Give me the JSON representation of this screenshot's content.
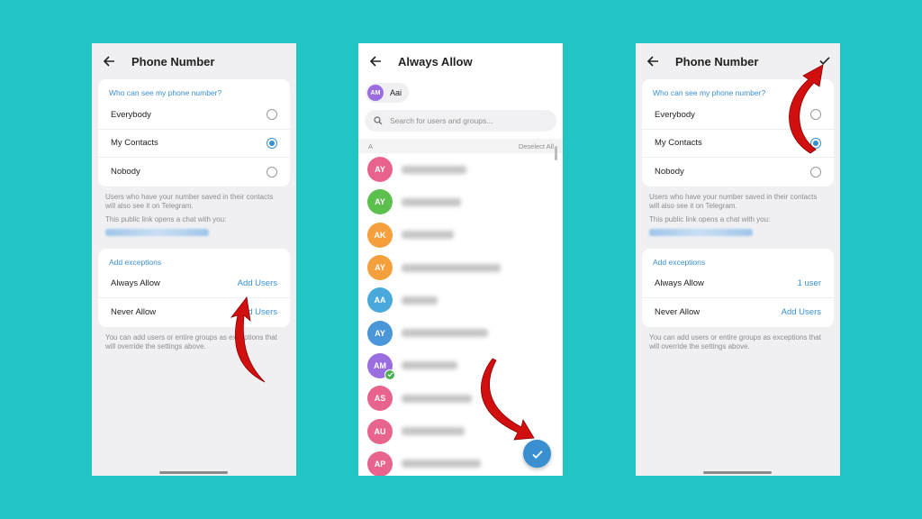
{
  "screen1": {
    "title": "Phone Number",
    "visibility_title": "Who can see my phone number?",
    "options": [
      {
        "label": "Everybody",
        "selected": false
      },
      {
        "label": "My Contacts",
        "selected": true
      },
      {
        "label": "Nobody",
        "selected": false
      }
    ],
    "note1": "Users who have your number saved in their contacts will also see it on Telegram.",
    "note2": "This public link opens a chat with you:",
    "exceptions_title": "Add exceptions",
    "always_allow_label": "Always Allow",
    "always_allow_value": "Add Users",
    "never_allow_label": "Never Allow",
    "never_allow_value": "Add Users",
    "footer_note": "You can add users or entire groups as exceptions that will override the settings above."
  },
  "screen2": {
    "title": "Always Allow",
    "chip_initials": "AM",
    "chip_name": "Aai",
    "search_placeholder": "Search for users and groups...",
    "section_letter": "A",
    "deselect_label": "Deselect All",
    "contacts": [
      {
        "initials": "AY",
        "color": "#e8648c",
        "checked": false
      },
      {
        "initials": "AY",
        "color": "#5cbf4e",
        "checked": false
      },
      {
        "initials": "AK",
        "color": "#f5a03c",
        "checked": false
      },
      {
        "initials": "AY",
        "color": "#f5a03c",
        "checked": false
      },
      {
        "initials": "AA",
        "color": "#4aa9dc",
        "checked": false
      },
      {
        "initials": "AY",
        "color": "#4a96d8",
        "checked": false
      },
      {
        "initials": "AM",
        "color": "#9a6ee0",
        "checked": true
      },
      {
        "initials": "AS",
        "color": "#e8648c",
        "checked": false
      },
      {
        "initials": "AU",
        "color": "#e8648c",
        "checked": false
      },
      {
        "initials": "AP",
        "color": "#e8648c",
        "checked": false
      }
    ]
  },
  "screen3": {
    "title": "Phone Number",
    "visibility_title": "Who can see my phone number?",
    "options": [
      {
        "label": "Everybody",
        "selected": false
      },
      {
        "label": "My Contacts",
        "selected": true
      },
      {
        "label": "Nobody",
        "selected": false
      }
    ],
    "note1": "Users who have your number saved in their contacts will also see it on Telegram.",
    "note2": "This public link opens a chat with you:",
    "exceptions_title": "Add exceptions",
    "always_allow_label": "Always Allow",
    "always_allow_value": "1 user",
    "never_allow_label": "Never Allow",
    "never_allow_value": "Add Users",
    "footer_note": "You can add users or entire groups as exceptions that will override the settings above."
  },
  "colors": {
    "background": "#22c5c3",
    "accent": "#3a8fd1",
    "annotation_arrow": "#d10f0f"
  },
  "icons": [
    "back-arrow-icon",
    "search-icon",
    "checkmark-icon",
    "red-annotation-arrow"
  ]
}
